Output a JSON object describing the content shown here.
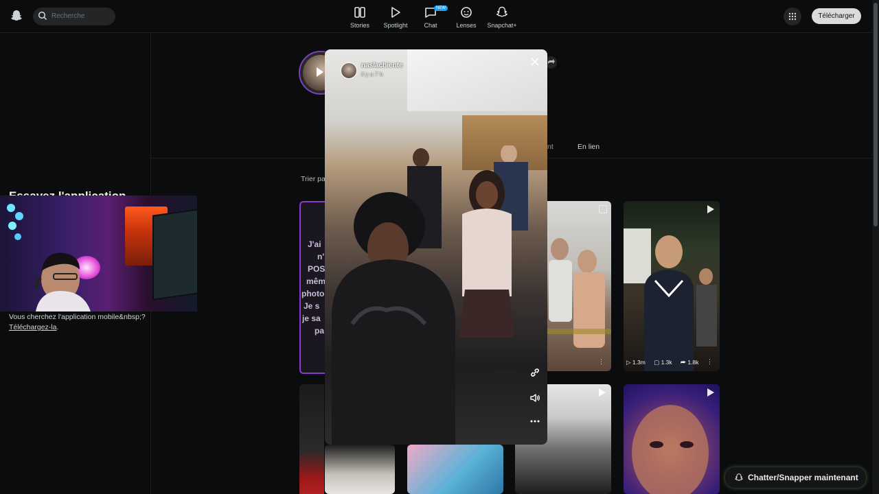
{
  "topbar": {
    "search_placeholder": "Recherche",
    "nav": [
      {
        "label": "Stories",
        "icon": "stories-icon"
      },
      {
        "label": "Spotlight",
        "icon": "play-icon"
      },
      {
        "label": "Chat",
        "icon": "chat-icon",
        "badge": "NEW"
      },
      {
        "label": "Lenses",
        "icon": "lenses-icon"
      },
      {
        "label": "Snapchat+",
        "icon": "ghost-plus-icon"
      }
    ],
    "download_label": "Télécharger"
  },
  "left": {
    "try_title": "Essayez l'application",
    "prompt_text": "Vous cherchez l'application mobile&nbsp;? ",
    "prompt_link": "Téléchargez-la",
    "prompt_end": "."
  },
  "profile": {
    "tab_partial": "nt",
    "tab_enlien": "En lien",
    "sort_label": "Trier pa"
  },
  "cards": {
    "text_card_lines": [
      "J'ai",
      "n'",
      "POS",
      "mêm",
      "photo",
      "Je s",
      "je sa",
      "pa"
    ],
    "card2_stats": {
      "views": "1.3m",
      "comments": "1.3k",
      "shares": "1.8k"
    }
  },
  "viewer": {
    "username": "naslachiente",
    "time": "il y a 7 h"
  },
  "chat_cta": {
    "label": "Chatter/Snapper maintenant"
  },
  "colors": {
    "accent_purple": "#8a3bd0",
    "badge_blue": "#1aa1ff"
  }
}
